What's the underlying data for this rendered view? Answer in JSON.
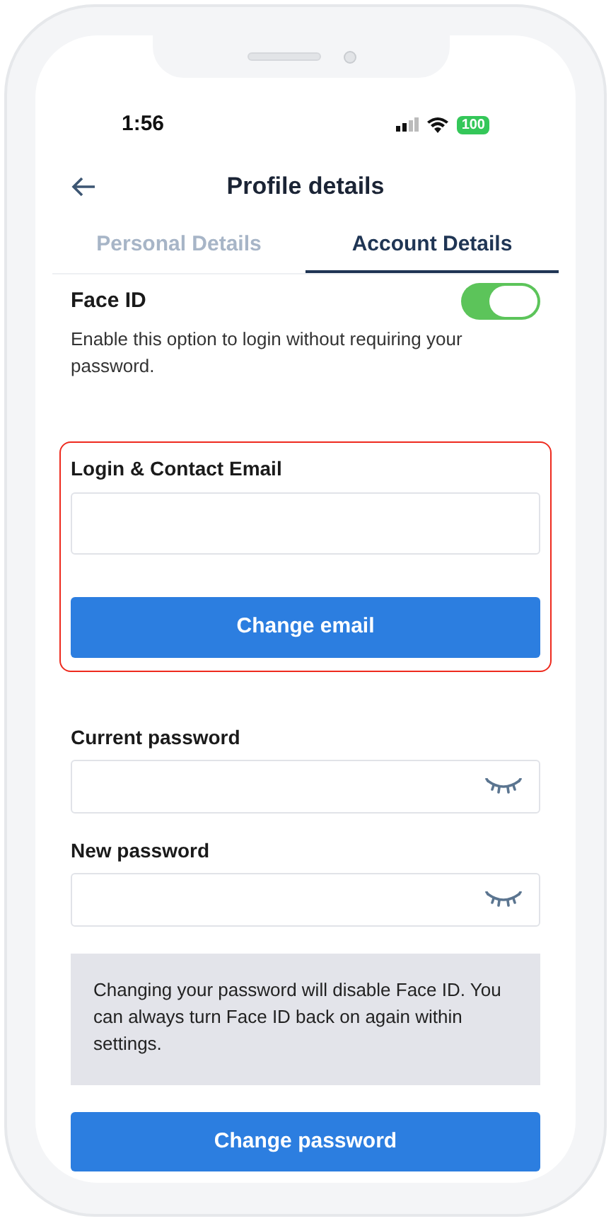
{
  "status_bar": {
    "time": "1:56",
    "battery": "100"
  },
  "header": {
    "title": "Profile details"
  },
  "tabs": [
    {
      "label": "Personal Details",
      "selected": false
    },
    {
      "label": "Account Details",
      "selected": true
    }
  ],
  "face_id": {
    "label": "Face ID",
    "on": true,
    "description": "Enable this option to login without requiring your password."
  },
  "email_section": {
    "highlighted": true,
    "label": "Login & Contact Email",
    "button": "Change email"
  },
  "password_fields": [
    {
      "label": "Current password"
    },
    {
      "label": "New password"
    }
  ],
  "notice": "Changing your password will disable Face ID. You can always turn Face ID back on again within settings.",
  "submit_button": "Change password"
}
